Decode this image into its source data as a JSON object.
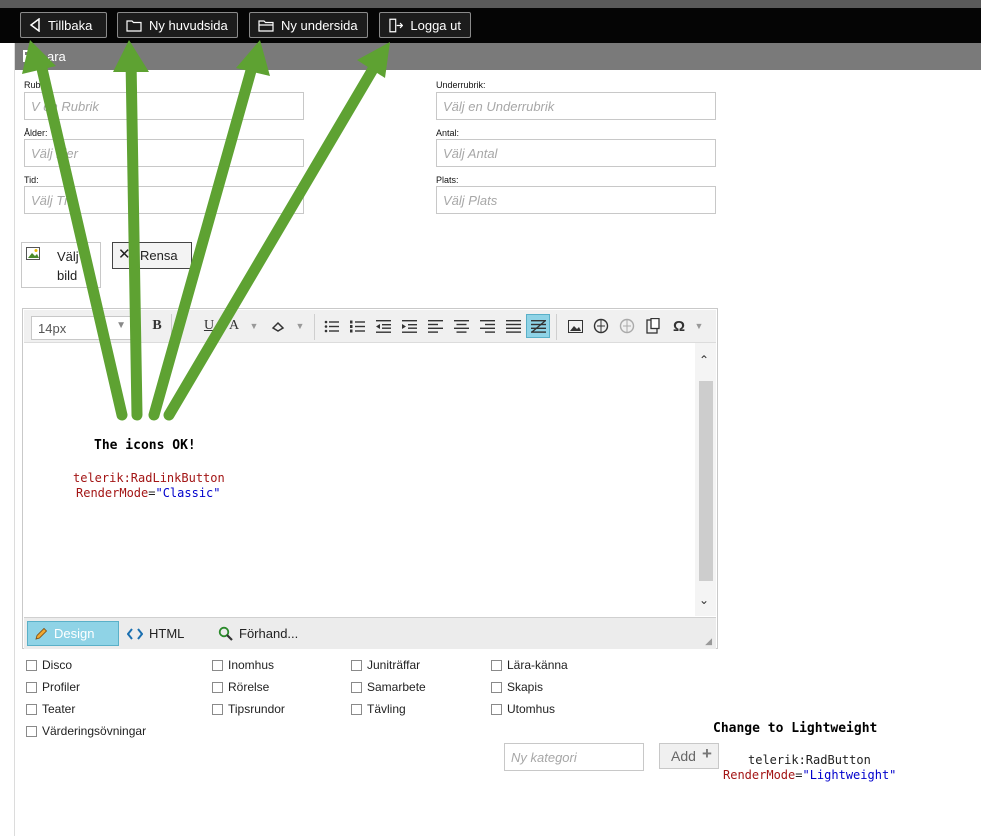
{
  "nav": {
    "back": "Tillbaka",
    "new_main": "Ny huvudsida",
    "new_sub": "Ny undersida",
    "logout": "Logga ut"
  },
  "savebar": {
    "label": "Spara",
    "label_visible": "ara"
  },
  "form": {
    "rubrik": {
      "label": "Rub",
      "placeholder": "Välj en Rubrik",
      "visible": "V      en Rubrik"
    },
    "underrubrik": {
      "label": "Underrubrik:",
      "placeholder": "Välj en Underrubrik"
    },
    "alder": {
      "label": "Ålder:",
      "placeholder": "Välj Ålder",
      "visible": "Välj  lder"
    },
    "antal": {
      "label": "Antal:",
      "placeholder": "Välj Antal"
    },
    "tid": {
      "label": "Tid:",
      "placeholder": "Välj Tid",
      "visible": "Välj Ti"
    },
    "plats": {
      "label": "Plats:",
      "placeholder": "Välj Plats"
    }
  },
  "image_buttons": {
    "choose": "Välj bild",
    "choose_l1": "Välj",
    "choose_l2": "bild",
    "clear": "Rensa"
  },
  "editor": {
    "font_size": "14px",
    "toolbar_icons": [
      "bold-icon",
      "underline-icon",
      "font-color-icon",
      "format-stripper-icon",
      "bullet-list-icon",
      "numbered-list-icon",
      "outdent-icon",
      "indent-icon",
      "align-left-icon",
      "align-center-icon",
      "align-right-icon",
      "justify-icon",
      "clear-alignment-icon",
      "image-manager-icon",
      "link-manager-icon",
      "unlink-icon",
      "paste-icon",
      "special-chars-icon"
    ],
    "modes": {
      "design": "Design",
      "html": "HTML",
      "preview": "Förhand..."
    }
  },
  "annotation_top": {
    "title": "The icons OK!",
    "line1": "telerik:RadLinkButton",
    "line2_attr": "RenderMode",
    "line2_eq": "=",
    "line2_val": "\"Classic\""
  },
  "categories": [
    [
      "Disco",
      "Inomhus",
      "Juniträffar",
      "Lära-känna"
    ],
    [
      "Profiler",
      "Rörelse",
      "Samarbete",
      "Skapis"
    ],
    [
      "Teater",
      "Tipsrundor",
      "Tävling",
      "Utomhus"
    ],
    [
      "Värderingsövningar"
    ]
  ],
  "new_category": {
    "placeholder": "Ny kategori",
    "add_label": "Add",
    "add_icon": "+"
  },
  "annotation_bottom": {
    "title": "Change to Lightweight",
    "line1": "telerik:RadButton",
    "line2_attr": "RenderMode",
    "line2_eq": "=",
    "line2_val": "\"Lightweight\""
  },
  "colors": {
    "arrow": "#5ea232",
    "design_active": "#8fd3e6",
    "topbar": "#050505"
  }
}
